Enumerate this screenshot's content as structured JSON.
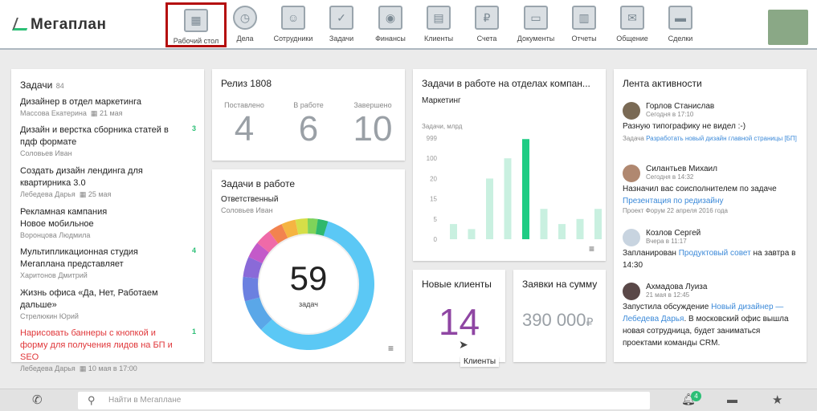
{
  "logo": "Мегаплан",
  "nav": [
    {
      "label": "Рабочий стол",
      "icon": "desktop-icon"
    },
    {
      "label": "Дела",
      "icon": "clock-icon"
    },
    {
      "label": "Сотрудники",
      "icon": "employees-icon"
    },
    {
      "label": "Задачи",
      "icon": "tasks-icon"
    },
    {
      "label": "Финансы",
      "icon": "safe-icon"
    },
    {
      "label": "Клиенты",
      "icon": "contacts-icon"
    },
    {
      "label": "Счета",
      "icon": "invoice-icon"
    },
    {
      "label": "Документы",
      "icon": "folder-icon"
    },
    {
      "label": "Отчеты",
      "icon": "report-icon"
    },
    {
      "label": "Общение",
      "icon": "chat-icon"
    },
    {
      "label": "Сделки",
      "icon": "briefcase-icon"
    }
  ],
  "tasks": {
    "title": "Задачи",
    "count": "84",
    "items": [
      {
        "title": "Дизайнер в отдел маркетинга",
        "person": "Массова Екатерина",
        "date": "21 мая",
        "count": ""
      },
      {
        "title": "Дизайн и верстка сборника статей в пдф формате",
        "person": "Соловьев Иван",
        "date": "",
        "count": "3"
      },
      {
        "title": "Создать дизайн лендинга для квартирника 3.0",
        "person": "Лебедева Дарья",
        "date": "25 мая",
        "count": ""
      },
      {
        "title": "Рекламная кампания Новое мобильное",
        "person": "Воронцова Людмила",
        "date": "",
        "count": ""
      },
      {
        "title": "Мультипликационная студия Мегаплана представляет",
        "person": "Харитонов Дмитрий",
        "date": "",
        "count": "4"
      },
      {
        "title": "Жизнь офиса «Да, Нет, Работаем дальше»",
        "person": "Стрелюкин Юрий",
        "date": "",
        "count": ""
      },
      {
        "title": "Нарисовать баннеры с кнопкой и форму для получения лидов на БП и SEO",
        "person": "Лебедева Дарья",
        "date": "10 мая в 17:00",
        "count": "1"
      }
    ]
  },
  "release": {
    "title": "Релиз 1808",
    "cols": [
      {
        "label": "Поставлено",
        "value": "4"
      },
      {
        "label": "В работе",
        "value": "6"
      },
      {
        "label": "Завершено",
        "value": "10"
      }
    ]
  },
  "inwork": {
    "title": "Задачи в работе",
    "sub": "Ответственный",
    "person": "Соловьев Иван",
    "value": "59",
    "unit": "задач"
  },
  "chart_data": {
    "type": "bar",
    "title": "Задачи в работе на отделах компан...",
    "subtitle": "Маркетинг",
    "ylabel": "Задачи, млрд",
    "yticks": [
      "999",
      "100",
      "20",
      "15",
      "5",
      "0"
    ],
    "values": [
      999,
      100,
      20,
      15,
      5,
      0
    ],
    "bars": [
      {
        "value": 15,
        "highlight": false
      },
      {
        "value": 10,
        "highlight": false
      },
      {
        "value": 60,
        "highlight": false
      },
      {
        "value": 80,
        "highlight": false
      },
      {
        "value": 99,
        "highlight": true
      },
      {
        "value": 30,
        "highlight": false
      },
      {
        "value": 15,
        "highlight": false
      },
      {
        "value": 20,
        "highlight": false
      },
      {
        "value": 30,
        "highlight": false
      },
      {
        "value": 10,
        "highlight": false
      }
    ],
    "color": "#c9f0e0",
    "accent": "#1fcc84"
  },
  "clients": {
    "title": "Новые клиенты",
    "value": "14",
    "tooltip": "Клиенты"
  },
  "orders": {
    "title": "Заявки на сумму",
    "value": "390 000",
    "currency": "₽"
  },
  "feed": {
    "title": "Лента активности",
    "items": [
      {
        "name": "Горлов Станислав",
        "time": "Сегодня в 17:10",
        "text": "Разную типографику не видел :-)",
        "meta_prefix": "Задача",
        "meta_link": "Разработать новый дизайн главной страницы [БП]"
      },
      {
        "name": "Силантьев Михаил",
        "time": "Сегодня в 14:32",
        "text": "Назначил вас соисполнителем по задаче",
        "link": "Презентация по редизайну",
        "meta": "Проект Форум 22 апреля 2016 года"
      },
      {
        "name": "Козлов Сергей",
        "time": "Вчера в 11:17",
        "text": "Запланирован",
        "link": "Продуктовый совет",
        "text2": "на завтра в 14:30"
      },
      {
        "name": "Ахмадова Луиза",
        "time": "21 мая в 12:45",
        "text": "Запустила обсуждение",
        "link": "Новый дизайнер — Лебедева Дарья",
        "text2": ". В московский офис вышла новая сотрудница, будет заниматься проектами команды CRM."
      }
    ]
  },
  "bottombar": {
    "search_placeholder": "Найти в Мегаплане",
    "notifications": "4"
  }
}
